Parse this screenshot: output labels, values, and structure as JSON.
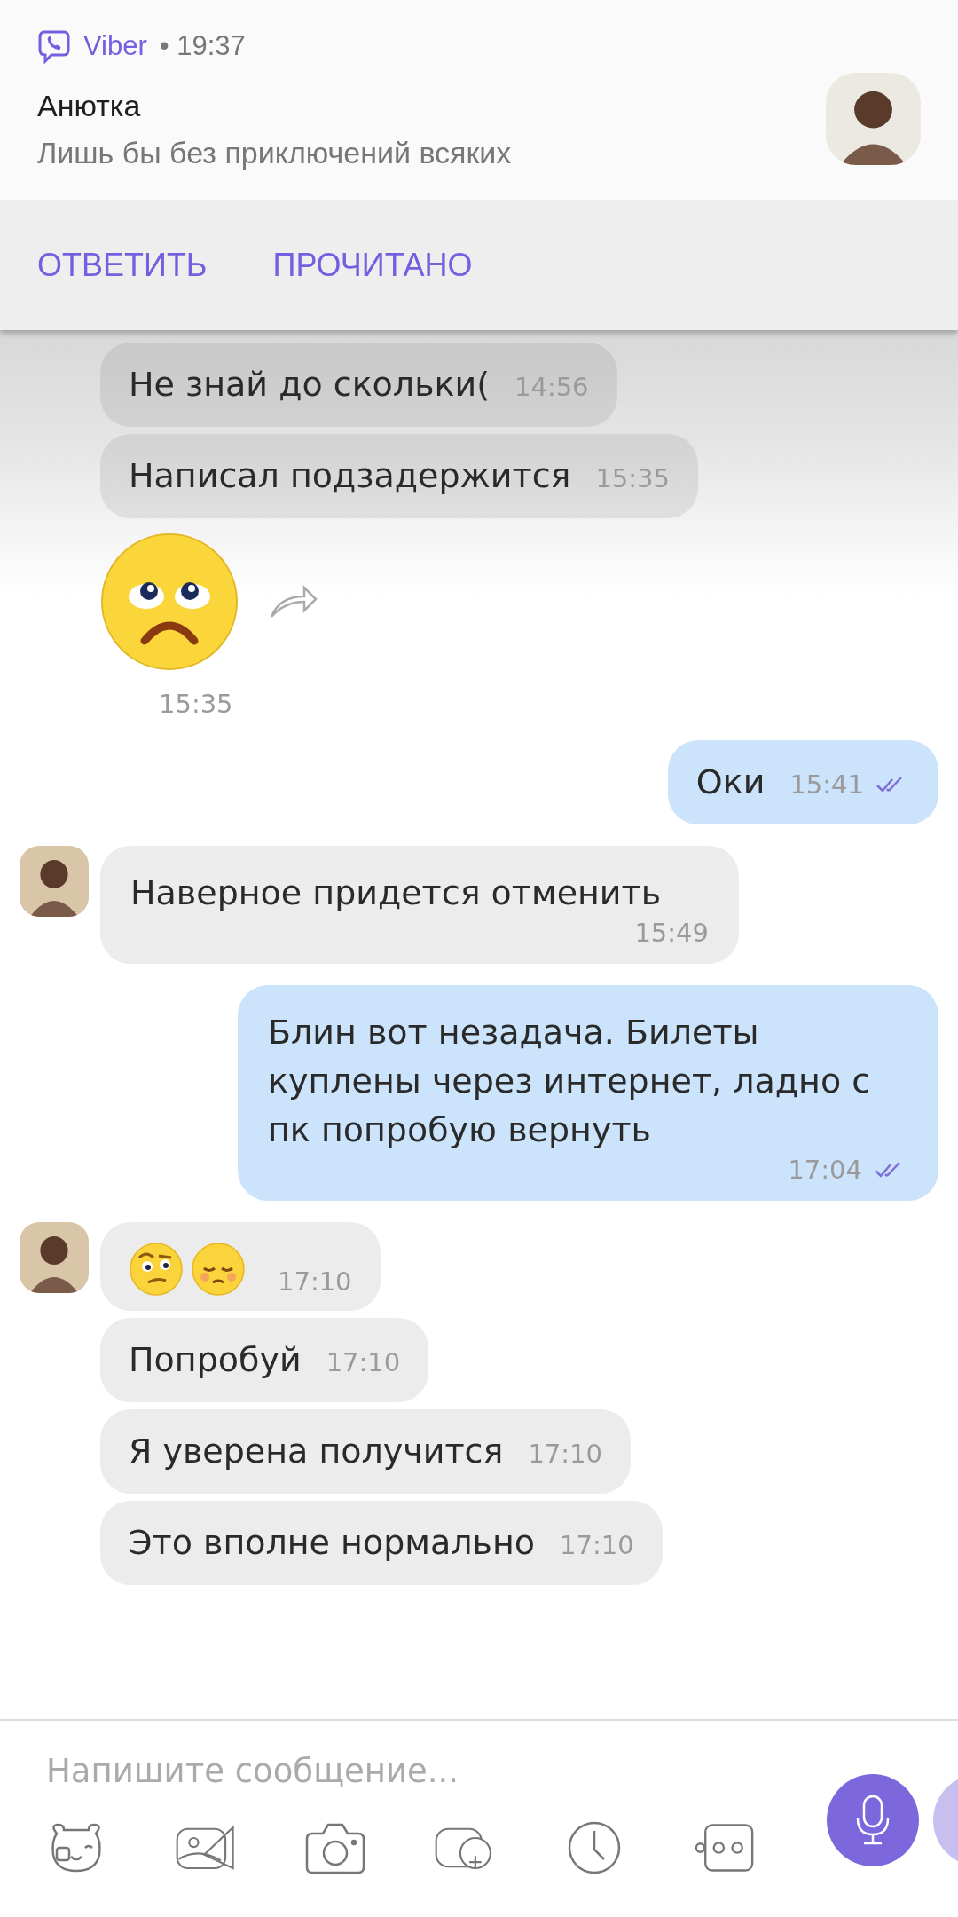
{
  "notification": {
    "app": "Viber",
    "time": "• 19:37",
    "sender": "Анютка",
    "text": "Лишь бы без приключений всяких",
    "actions": [
      "ОТВЕТИТЬ",
      "ПРОЧИТАНО"
    ]
  },
  "messages": [
    {
      "kind": "text",
      "outgoing": false,
      "avatar": false,
      "text": "Не знай до скольки(",
      "time": "14:56"
    },
    {
      "kind": "text",
      "outgoing": false,
      "avatar": false,
      "text": "Написал подзадержится",
      "time": "15:35"
    },
    {
      "kind": "sticker",
      "outgoing": false,
      "avatar": false,
      "time": "15:35"
    },
    {
      "kind": "text",
      "outgoing": true,
      "read": true,
      "text": "Оки",
      "time": "15:41"
    },
    {
      "kind": "text",
      "outgoing": false,
      "avatar": true,
      "text": "Наверное придется отменить",
      "time": "15:49"
    },
    {
      "kind": "text",
      "outgoing": true,
      "read": true,
      "text": "Блин вот незадача. Билеты куплены через интернет, ладно с пк попробую вернуть",
      "time": "17:04"
    },
    {
      "kind": "emoji",
      "outgoing": false,
      "avatar": true,
      "time": "17:10"
    },
    {
      "kind": "text",
      "outgoing": false,
      "avatar": false,
      "text": "Попробуй",
      "time": "17:10"
    },
    {
      "kind": "text",
      "outgoing": false,
      "avatar": false,
      "text": "Я уверена получится",
      "time": "17:10"
    },
    {
      "kind": "text",
      "outgoing": false,
      "avatar": false,
      "text": "Это вполне нормально",
      "time": "17:10"
    }
  ],
  "composer": {
    "placeholder": "Напишите сообщение..."
  }
}
